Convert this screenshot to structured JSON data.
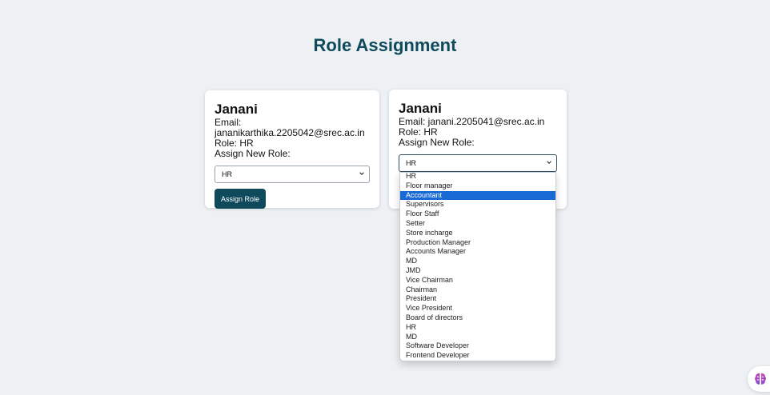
{
  "page": {
    "title": "Role Assignment"
  },
  "cards": [
    {
      "name": "Janani",
      "email": "Email: jananikarthika.2205042@srec.ac.in",
      "role": "Role: HR",
      "assign_label": "Assign New Role:",
      "select_value": "HR",
      "button_label": "Assign Role"
    },
    {
      "name": "Janani",
      "email": "Email: janani.2205041@srec.ac.in",
      "role": "Role: HR",
      "assign_label": "Assign New Role:",
      "select_value": "HR"
    }
  ],
  "dropdown": {
    "highlighted": "Accountant",
    "options": [
      "HR",
      "Floor manager",
      "Accountant",
      "Supervisors",
      "Floor Staff",
      "Setter",
      "Store incharge",
      "Production Manager",
      "Accounts Manager",
      "MD",
      "JMD",
      "Vice Chairman",
      "Chairman",
      "President",
      "Vice President",
      "Board of directors",
      "HR",
      "MD",
      "Software Developer",
      "Frontend Developer"
    ]
  },
  "colors": {
    "accent": "#0f4a5c",
    "highlight": "#1a6ad6",
    "background": "#eef1f4"
  },
  "icons": {
    "select_arrow": "chevron-down-icon",
    "widget": "brain-icon"
  }
}
